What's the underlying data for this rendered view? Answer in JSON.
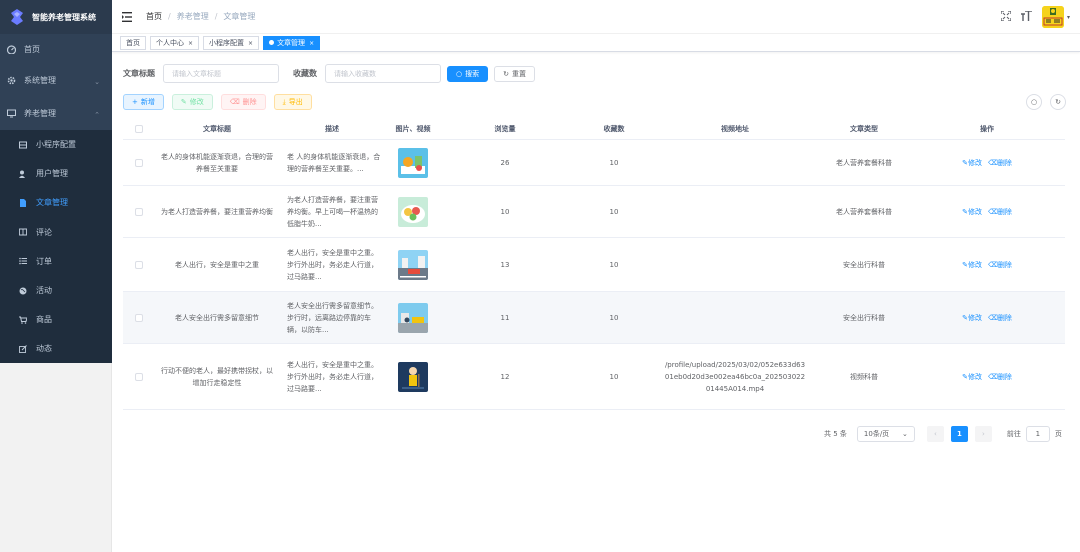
{
  "app": {
    "title": "智能养老管理系统"
  },
  "sidebar": {
    "items": [
      {
        "label": "首页",
        "icon": "dashboard-icon"
      },
      {
        "label": "系统管理",
        "icon": "gear-icon"
      },
      {
        "label": "养老管理",
        "icon": "monitor-icon"
      }
    ],
    "sub_items": [
      {
        "label": "小程序配置",
        "icon": "grid-icon"
      },
      {
        "label": "用户管理",
        "icon": "user-icon"
      },
      {
        "label": "文章管理",
        "icon": "document-icon"
      },
      {
        "label": "评论",
        "icon": "book-icon"
      },
      {
        "label": "订单",
        "icon": "list-icon"
      },
      {
        "label": "活动",
        "icon": "globe-icon"
      },
      {
        "label": "商品",
        "icon": "cart-icon"
      },
      {
        "label": "动态",
        "icon": "edit-icon"
      }
    ]
  },
  "header": {
    "breadcrumb": [
      "首页",
      "养老管理",
      "文章管理"
    ]
  },
  "tags": [
    {
      "label": "首页"
    },
    {
      "label": "个人中心"
    },
    {
      "label": "小程序配置"
    },
    {
      "label": "文章管理"
    }
  ],
  "search": {
    "title_label": "文章标题",
    "title_placeholder": "请输入文章标题",
    "fav_label": "收藏数",
    "fav_placeholder": "请输入收藏数",
    "search_btn": "搜索",
    "reset_btn": "重置"
  },
  "toolbar": {
    "add": "新增",
    "edit": "修改",
    "delete": "删除",
    "export": "导出"
  },
  "table": {
    "headers": [
      "文章标题",
      "描述",
      "图片、视频",
      "浏览量",
      "收藏数",
      "视频地址",
      "文章类型",
      "操作"
    ],
    "rows": [
      {
        "title": "老人的身体机能逐渐衰退，合理的营养餐至关重要",
        "desc": "老 人的身体机能逐渐衰退，合理的营养餐至关重要。...",
        "views": "26",
        "fav": "10",
        "video": "",
        "type": "老人营养套餐科普",
        "edit": "修改",
        "del": "删除"
      },
      {
        "title": "为老人打造营养餐，要注重营养均衡",
        "desc": "为老人打造营养餐，要注重营养均衡。早上可喝一杯温热的低脂牛奶...",
        "views": "10",
        "fav": "10",
        "video": "",
        "type": "老人营养套餐科普",
        "edit": "修改",
        "del": "删除"
      },
      {
        "title": "老人出行，安全是重中之重",
        "desc": "老人出行，安全是重中之重。步行外出时，务必走人行道，过马路要...",
        "views": "13",
        "fav": "10",
        "video": "",
        "type": "安全出行科普",
        "edit": "修改",
        "del": "删除"
      },
      {
        "title": "老人安全出行需多留意细节",
        "desc": "老人安全出行需多留意细节。步行时，远离路边停靠的车辆，以防车...",
        "views": "11",
        "fav": "10",
        "video": "",
        "type": "安全出行科普",
        "edit": "修改",
        "del": "删除"
      },
      {
        "title": "行动不便的老人，最好携带拐杖，以增加行走稳定性",
        "desc": "老人出行，安全是重中之重。步行外出时，务必走人行道，过马路要...",
        "views": "12",
        "fav": "10",
        "video": "/profile/upload/2025/03/02/052e633d6301eb0d20d3e002ea46bc0a_20250302201445A014.mp4",
        "type": "视频科普",
        "edit": "修改",
        "del": "删除"
      }
    ]
  },
  "pagination": {
    "total": "共 5 条",
    "page_size": "10条/页",
    "current": "1",
    "goto_label": "前往",
    "goto_value": "1",
    "page_suffix": "页"
  },
  "colors": {
    "primary": "#1890ff",
    "sidebar_bg": "#304156",
    "submenu_bg": "#1f2d3d"
  }
}
